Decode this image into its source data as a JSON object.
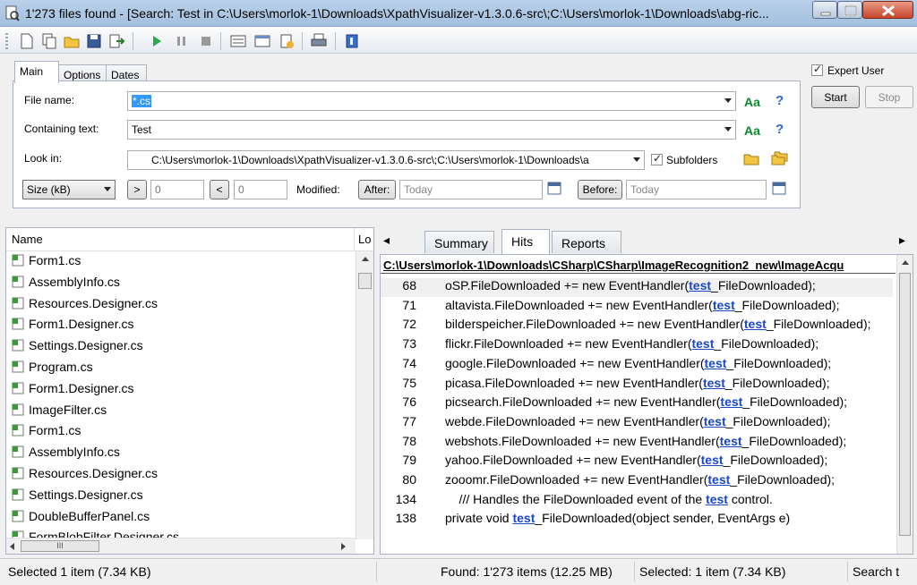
{
  "window": {
    "title": "1'273 files found - [Search: Test in C:\\Users\\morlok-1\\Downloads\\XpathVisualizer-v1.3.0.6-src\\;C:\\Users\\morlok-1\\Downloads\\abg-ric..."
  },
  "tabs": [
    "Main",
    "Options",
    "Dates"
  ],
  "form": {
    "file_name_label": "File name:",
    "file_name_value": "*.cs",
    "containing_label": "Containing text:",
    "containing_value": "Test",
    "look_in_label": "Look in:",
    "look_in_value": "C:\\Users\\morlok-1\\Downloads\\XpathVisualizer-v1.3.0.6-src\\;C:\\Users\\morlok-1\\Downloads\\a",
    "subfolders_label": "Subfolders",
    "aa_label": "Aa",
    "help_label": "?",
    "size_select": "Size (kB)",
    "gt_label": ">",
    "gt_value": "0",
    "lt_label": "<",
    "lt_value": "0",
    "modified_label": "Modified:",
    "after_label": "After:",
    "after_placeholder": "Today",
    "before_label": "Before:",
    "before_placeholder": "Today"
  },
  "right_controls": {
    "expert_user_label": "Expert User",
    "start_label": "Start",
    "stop_label": "Stop"
  },
  "file_list": {
    "col_name": "Name",
    "col_location": "Lo",
    "items": [
      "Form1.cs",
      "AssemblyInfo.cs",
      "Resources.Designer.cs",
      "Form1.Designer.cs",
      "Settings.Designer.cs",
      "Program.cs",
      "Form1.Designer.cs",
      "ImageFilter.cs",
      "Form1.cs",
      "AssemblyInfo.cs",
      "Resources.Designer.cs",
      "Settings.Designer.cs",
      "DoubleBufferPanel.cs",
      "FormBlobFilter.Designer.cs"
    ],
    "hscroll_grip": "III"
  },
  "results": {
    "tabs": [
      "Summary",
      "Hits",
      "Reports"
    ],
    "path": "C:\\Users\\morlok-1\\Downloads\\CSharp\\CSharp\\ImageRecognition2_new\\ImageAcqu",
    "hits": [
      {
        "line": "68",
        "pre": "oSP.FileDownloaded += new EventHandler(",
        "kw": "test",
        "post": "_FileDownloaded);"
      },
      {
        "line": "71",
        "pre": "altavista.FileDownloaded += new EventHandler(",
        "kw": "test",
        "post": "_FileDownloaded);"
      },
      {
        "line": "72",
        "pre": "bilderspeicher.FileDownloaded += new EventHandler(",
        "kw": "test",
        "post": "_FileDownloaded);"
      },
      {
        "line": "73",
        "pre": "flickr.FileDownloaded += new EventHandler(",
        "kw": "test",
        "post": "_FileDownloaded);"
      },
      {
        "line": "74",
        "pre": "google.FileDownloaded += new EventHandler(",
        "kw": "test",
        "post": "_FileDownloaded);"
      },
      {
        "line": "75",
        "pre": "picasa.FileDownloaded += new EventHandler(",
        "kw": "test",
        "post": "_FileDownloaded);"
      },
      {
        "line": "76",
        "pre": "picsearch.FileDownloaded += new EventHandler(",
        "kw": "test",
        "post": "_FileDownloaded);"
      },
      {
        "line": "77",
        "pre": "webde.FileDownloaded += new EventHandler(",
        "kw": "test",
        "post": "_FileDownloaded);"
      },
      {
        "line": "78",
        "pre": "webshots.FileDownloaded += new EventHandler(",
        "kw": "test",
        "post": "_FileDownloaded);"
      },
      {
        "line": "79",
        "pre": "yahoo.FileDownloaded += new EventHandler(",
        "kw": "test",
        "post": "_FileDownloaded);"
      },
      {
        "line": "80",
        "pre": "zooomr.FileDownloaded += new EventHandler(",
        "kw": "test",
        "post": "_FileDownloaded);"
      },
      {
        "line": "134",
        "pre": "    /// Handles the FileDownloaded event of the ",
        "kw": "test",
        "post": " control."
      },
      {
        "line": "138",
        "pre": "private void ",
        "kw": "test",
        "post": "_FileDownloaded(object sender, EventArgs e)"
      }
    ],
    "tab_left_arrow": "◂",
    "tab_right_arrow": "▸"
  },
  "status": {
    "left": "Selected 1 item (7.34 KB)",
    "found": "Found: 1'273 items (12.25 MB)",
    "selected": "Selected: 1 item (7.34 KB)",
    "search": "Search t"
  }
}
